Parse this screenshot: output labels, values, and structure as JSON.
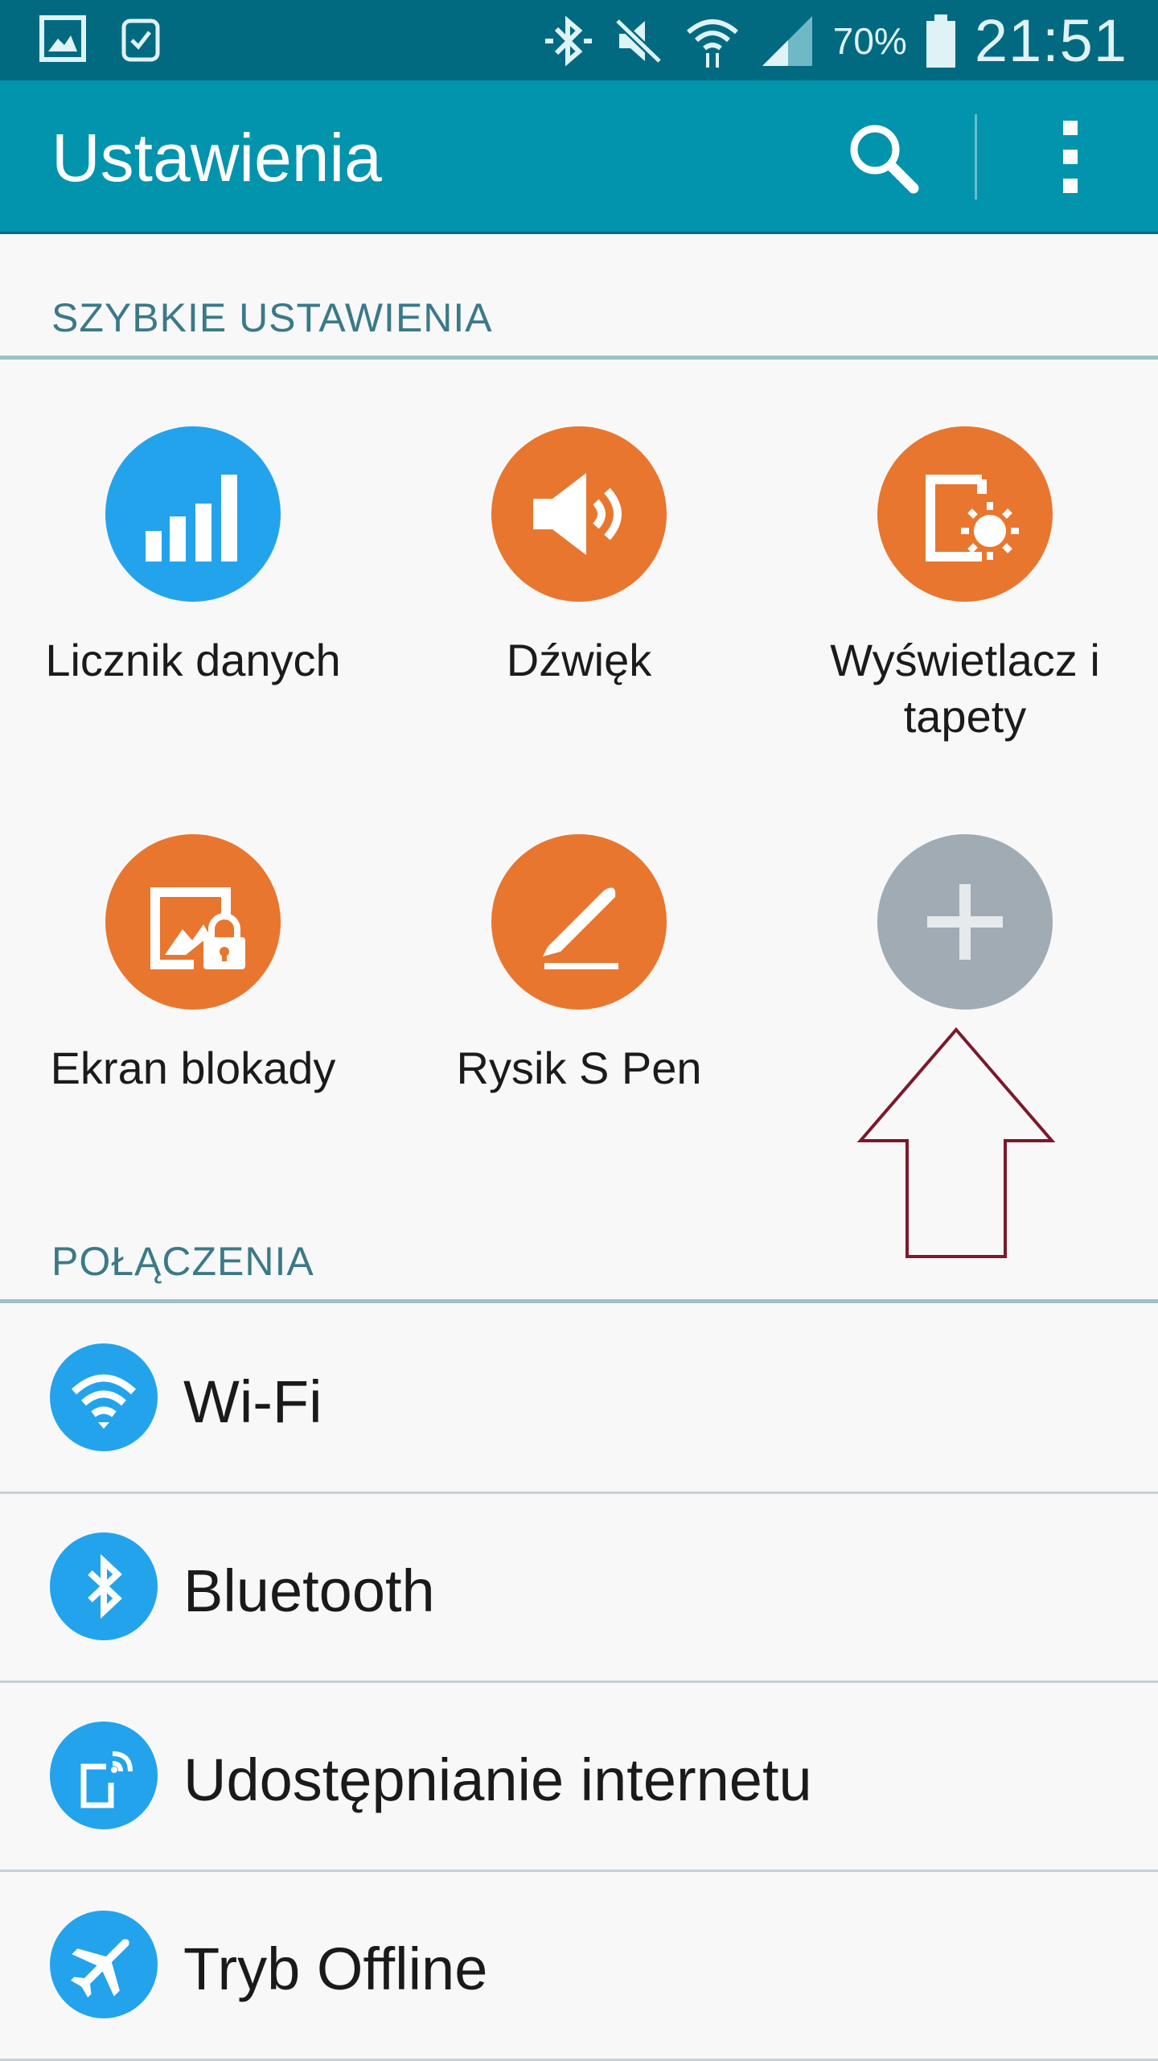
{
  "status_bar": {
    "battery_percent": "70%",
    "time": "21:51",
    "left_icons": [
      "gallery-icon",
      "watch-icon"
    ],
    "right_icons": [
      "bluetooth-icon",
      "mute-icon",
      "wifi-icon",
      "signal-icon",
      "battery-icon"
    ]
  },
  "action_bar": {
    "title": "Ustawienia",
    "search_icon": "search-icon",
    "more_icon": "more-vert-icon"
  },
  "colors": {
    "status_bar": "#016a80",
    "action_bar": "#0293ad",
    "section_text": "#3b7988",
    "tile_orange": "#e8762f",
    "tile_blue": "#23a3ec",
    "tile_gray": "#a0abb4",
    "arrow": "#7a1a2b"
  },
  "quick_settings": {
    "header": "SZYBKIE USTAWIENIA",
    "tiles": [
      {
        "label": "Licznik danych",
        "icon": "data-usage-icon",
        "color": "#23a3ec"
      },
      {
        "label": "Dźwięk",
        "icon": "sound-icon",
        "color": "#e8762f"
      },
      {
        "label": "Wyświetlacz i tapety",
        "icon": "display-wallpaper-icon",
        "color": "#e8762f"
      },
      {
        "label": "Ekran blokady",
        "icon": "lock-screen-icon",
        "color": "#e8762f"
      },
      {
        "label": "Rysik S Pen",
        "icon": "s-pen-icon",
        "color": "#e8762f"
      },
      {
        "label": "",
        "icon": "add-icon",
        "color": "#a0abb4"
      }
    ]
  },
  "connections": {
    "header": "POŁĄCZENIA",
    "items": [
      {
        "label": "Wi-Fi",
        "icon": "wifi-icon"
      },
      {
        "label": "Bluetooth",
        "icon": "bluetooth-icon"
      },
      {
        "label": "Udostępnianie internetu",
        "icon": "tethering-icon"
      },
      {
        "label": "Tryb Offline",
        "icon": "airplane-icon"
      }
    ]
  }
}
